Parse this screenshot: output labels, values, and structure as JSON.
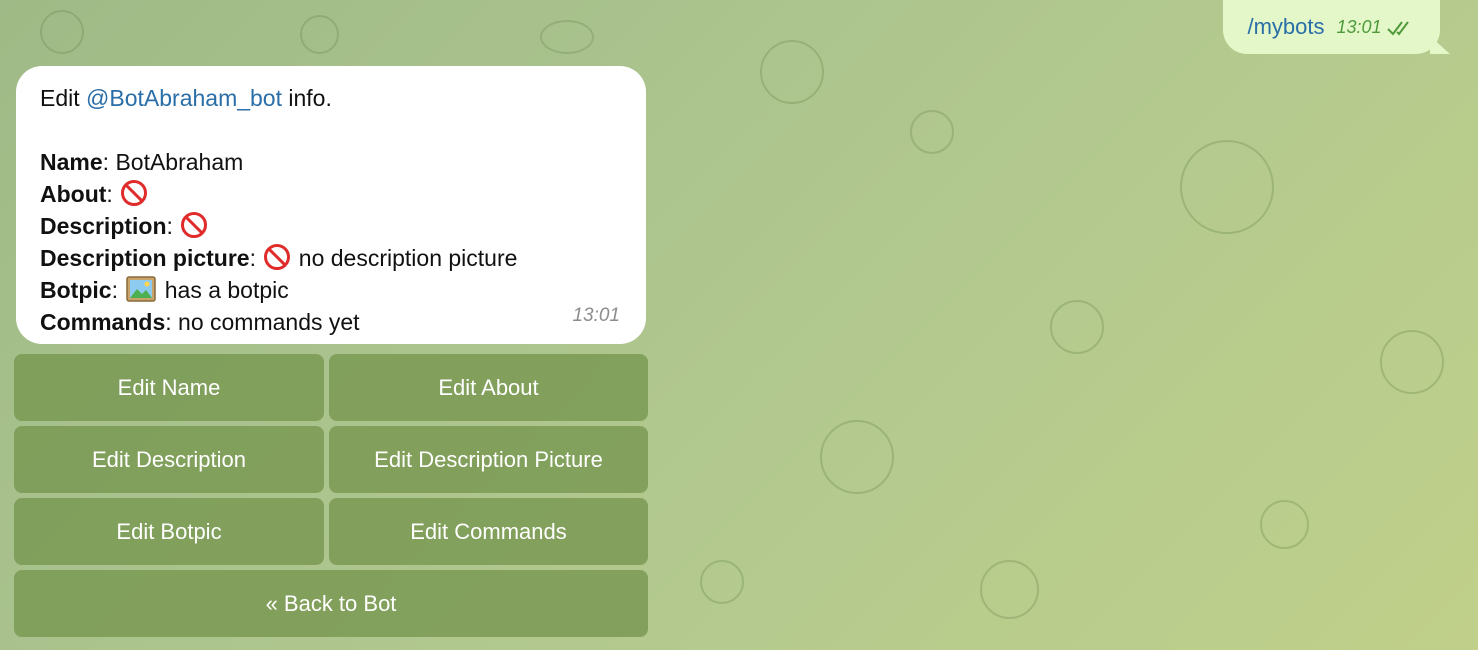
{
  "outgoing": {
    "text": "/mybots",
    "time": "13:01"
  },
  "message": {
    "intro_prefix": "Edit ",
    "bot_handle": "@BotAbraham_bot",
    "intro_suffix": " info.",
    "name_label": "Name",
    "name_value": "BotAbraham",
    "about_label": "About",
    "description_label": "Description",
    "description_picture_label": "Description picture",
    "description_picture_value": "no description picture",
    "botpic_label": "Botpic",
    "botpic_value": "has a botpic",
    "commands_label": "Commands",
    "commands_value": "no commands yet",
    "time": "13:01"
  },
  "keyboard": {
    "edit_name": "Edit Name",
    "edit_about": "Edit About",
    "edit_description": "Edit Description",
    "edit_description_picture": "Edit Description Picture",
    "edit_botpic": "Edit Botpic",
    "edit_commands": "Edit Commands",
    "back_to_bot": "« Back to Bot"
  },
  "icons": {
    "status": "double-check-icon",
    "not_set": "no-entry-icon",
    "picture": "framed-picture-icon"
  },
  "colors": {
    "link": "#2a6ea8",
    "outgoing_bubble": "#e3f7c9",
    "keyboard_button": "#76964e",
    "no_entry": "#e02b2b"
  }
}
